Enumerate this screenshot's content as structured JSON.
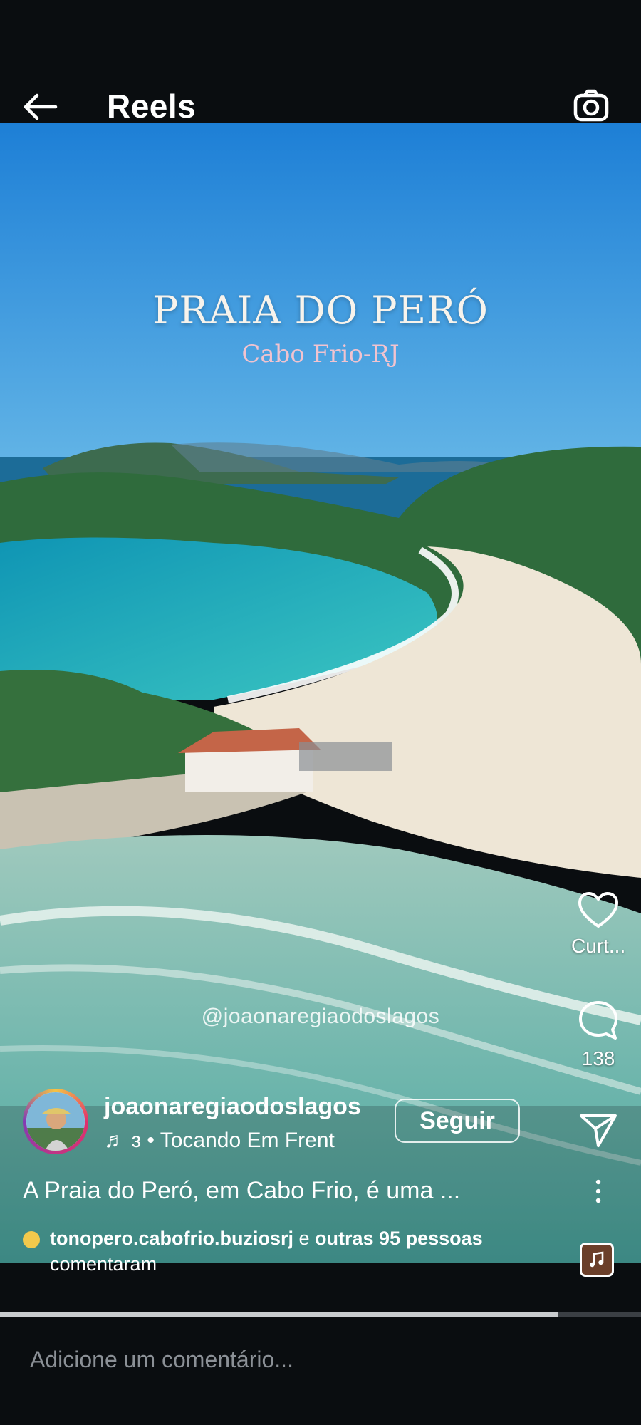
{
  "header": {
    "title": "Reels",
    "back_icon": "back-arrow-icon",
    "camera_icon": "camera-icon"
  },
  "video": {
    "overlay_title": "PRAIA DO PERÓ",
    "overlay_subtitle": "Cabo Frio-RJ",
    "watermark": "@joaonaregiaodoslagos"
  },
  "actions": {
    "like": {
      "icon": "heart-icon",
      "label": "Curt..."
    },
    "comment": {
      "icon": "comment-bubble-icon",
      "count": "138"
    },
    "share": {
      "icon": "send-icon"
    },
    "more": {
      "icon": "more-vertical-icon"
    },
    "audio": {
      "icon": "music-note-icon"
    }
  },
  "post": {
    "username": "joaonaregiaodoslagos",
    "music": "♬ ɜ • Tocando Em Frent",
    "follow_label": "Seguir",
    "caption": "A Praia do Peró, em Cabo Frio, é uma ...",
    "comments_user": "tonopero.cabofrio.buziosrj",
    "comments_mid": " e ",
    "comments_others": "outras 95 pessoas",
    "comments_tail": "comentaram"
  },
  "progress": {
    "fraction": 0.87
  },
  "comment_box": {
    "placeholder": "Adicione um comentário..."
  },
  "colors": {
    "background": "#0a0d10",
    "sky": "#2f8fd8",
    "sea": "#1aa6b8",
    "sand": "#eee6d6"
  }
}
